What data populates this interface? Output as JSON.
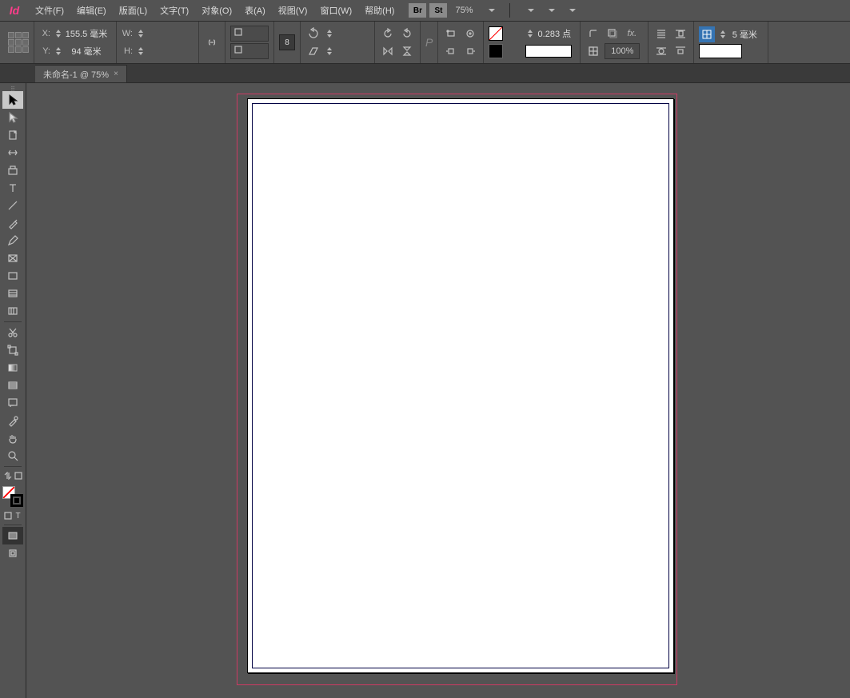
{
  "app": {
    "logo": "Id"
  },
  "menu": {
    "items": [
      "文件(F)",
      "编辑(E)",
      "版面(L)",
      "文字(T)",
      "对象(O)",
      "表(A)",
      "视图(V)",
      "窗口(W)",
      "帮助(H)"
    ],
    "br": "Br",
    "st": "St",
    "zoom": "75%"
  },
  "control": {
    "x_label": "X:",
    "x_val": "155.5 毫米",
    "y_label": "Y:",
    "y_val": "94 毫米",
    "w_label": "W:",
    "w_val": "",
    "h_label": "H:",
    "h_val": "",
    "num8": "8",
    "p_label": "P",
    "stroke_val": "0.283 点",
    "opacity": "100%",
    "grid_val": "5 毫米"
  },
  "doc": {
    "tab": "未命名-1 @ 75%"
  },
  "tools": {
    "label": "……"
  }
}
